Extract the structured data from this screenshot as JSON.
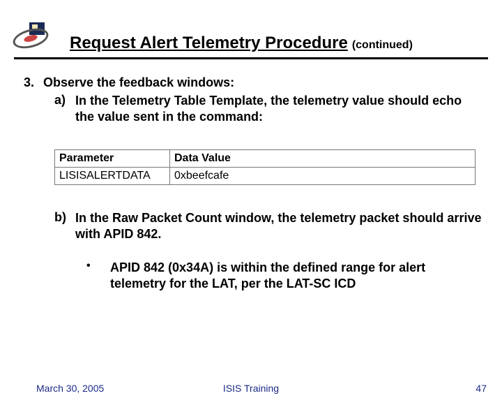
{
  "header": {
    "title_main": "Request Alert Telemetry Procedure",
    "title_cont": "(continued)"
  },
  "step": {
    "number": "3.",
    "text": "Observe the feedback windows:",
    "sub": [
      {
        "marker": "a)",
        "text": "In the Telemetry Table Template, the telemetry value should echo the value sent in the command:"
      },
      {
        "marker": "b)",
        "text": "In the Raw Packet Count window, the telemetry packet should arrive with APID 842."
      }
    ],
    "bullet": {
      "marker": "•",
      "text": "APID 842 (0x34A) is within the defined range for alert telemetry for the LAT, per the LAT-SC ICD"
    }
  },
  "table": {
    "headers": [
      "Parameter",
      "Data Value"
    ],
    "rows": [
      [
        "LISISALERTDATA",
        "0xbeefcafe"
      ]
    ]
  },
  "footer": {
    "date": "March 30, 2005",
    "center": "ISIS Training",
    "page": "47"
  }
}
